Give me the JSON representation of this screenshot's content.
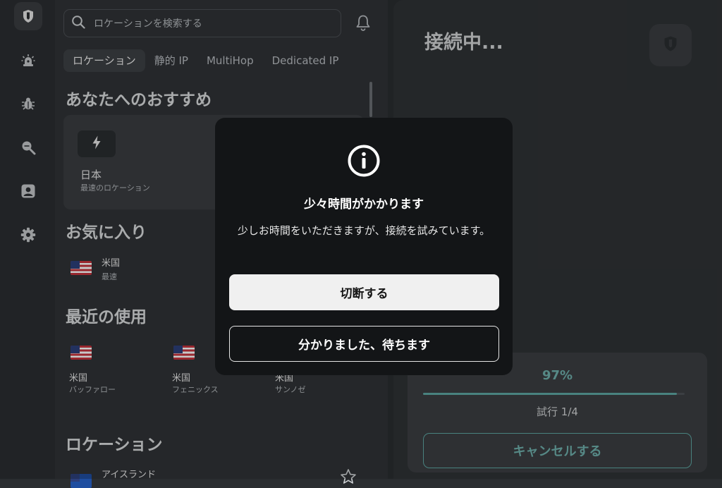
{
  "sidebar": {
    "items": [
      {
        "icon": "shield-logo-icon",
        "active": true
      },
      {
        "icon": "siren-alert-icon"
      },
      {
        "icon": "bug-icon"
      },
      {
        "icon": "search-zoom-icon"
      },
      {
        "icon": "account-icon"
      },
      {
        "icon": "gear-icon"
      }
    ]
  },
  "search": {
    "placeholder": "ロケーションを検索する",
    "icon": "search-icon"
  },
  "header": {
    "bell_icon": "bell-icon"
  },
  "tabs": [
    {
      "label": "ロケーション",
      "active": true
    },
    {
      "label": "静的 IP"
    },
    {
      "label": "MultiHop"
    },
    {
      "label": "Dedicated IP"
    }
  ],
  "recommended": {
    "heading": "あなたへのおすすめ",
    "card": {
      "icon": "bolt-icon",
      "country": "日本",
      "subtitle": "最速のロケーション"
    }
  },
  "favorites": {
    "heading": "お気に入り",
    "items": [
      {
        "country": "米国",
        "city": "最速"
      }
    ]
  },
  "recent": {
    "heading": "最近の使用",
    "items": [
      {
        "country": "米国",
        "city": "バッファロー"
      },
      {
        "country": "米国",
        "city": "フェニックス"
      },
      {
        "country": "米国",
        "city": "サンノゼ"
      }
    ]
  },
  "locations": {
    "heading": "ロケーション",
    "items": [
      {
        "country": "アイスランド"
      }
    ]
  },
  "status": {
    "title": "接続中...",
    "progress_percent": 97,
    "progress_label": "97%",
    "attempt_label": "試行 1/4",
    "cancel_label": "キャンセルする"
  },
  "modal": {
    "icon": "info-icon",
    "title": "少々時間がかかります",
    "body": "少しお時間をいただきますが、接続を試みています。",
    "primary_label": "切断する",
    "secondary_label": "分かりました、待ちます"
  },
  "colors": {
    "accent": "#5ea7a3",
    "modal_bg": "#131517",
    "panel_bg": "#303336"
  }
}
